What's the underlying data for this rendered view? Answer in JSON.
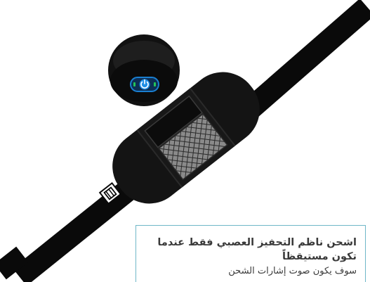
{
  "page": {
    "top_heading": "",
    "info_card": {
      "title": "اشحن ناظم التحفيز العصبي فقط عندما تكون مستيقظاً",
      "body": "سوف يكون صوت إشارات الشحن"
    },
    "usb_label": "▣"
  },
  "colors": {
    "cable": "#0a0a0a",
    "body": "#111111",
    "pod": "#1b1b1b",
    "window": "#8a8a8a",
    "button_ring": "#1a7fd1",
    "button_center": "#1e8fe6",
    "led": "#22c45a",
    "card_border": "#6fb7c8"
  },
  "icons": [
    "power-icon",
    "usb-icon"
  ]
}
